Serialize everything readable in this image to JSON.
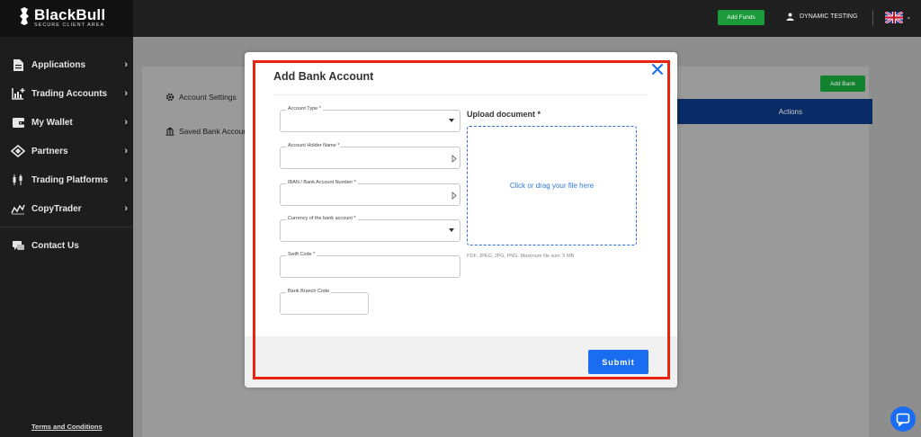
{
  "brand": {
    "name": "BlackBull",
    "tagline": "SECURE CLIENT AREA"
  },
  "sidebar": {
    "items": [
      {
        "label": "Applications",
        "icon": "document-icon"
      },
      {
        "label": "Trading Accounts",
        "icon": "chart-plus-icon"
      },
      {
        "label": "My Wallet",
        "icon": "wallet-icon"
      },
      {
        "label": "Partners",
        "icon": "handshake-icon"
      },
      {
        "label": "Trading Platforms",
        "icon": "candlestick-icon"
      },
      {
        "label": "CopyTrader",
        "icon": "trend-icon"
      }
    ],
    "contact": {
      "label": "Contact Us",
      "icon": "chat-bubbles-icon"
    },
    "terms": "Terms and Conditions"
  },
  "topbar": {
    "add_funds": "Add Funds",
    "user_name": "DYNAMIC TESTING",
    "language_icon": "uk-flag-icon"
  },
  "main": {
    "settings_menu": [
      "Account Settings",
      "Saved Bank Accoun"
    ],
    "add_bank": "Add Bank",
    "table_header_actions": "Actions"
  },
  "modal": {
    "title": "Add Bank Account",
    "fields": {
      "account_type": "Account Type *",
      "holder_name": "Account Holder Name *",
      "iban": "IBAN / Bank Account Number *",
      "currency": "Currency of the bank account *",
      "swift": "Swift Code *",
      "branch": "Bank Branch Code"
    },
    "upload_title": "Upload document *",
    "dropzone_text": "Click or drag your file here",
    "dropzone_hint": "PDF, JPEG, JPG, PNG. Maximum file size: 5 MB",
    "submit": "Submit"
  },
  "colors": {
    "accent": "#1a6cf0",
    "highlight": "#e8230f",
    "green": "#1a9a3a",
    "navy": "#0a2c66"
  }
}
